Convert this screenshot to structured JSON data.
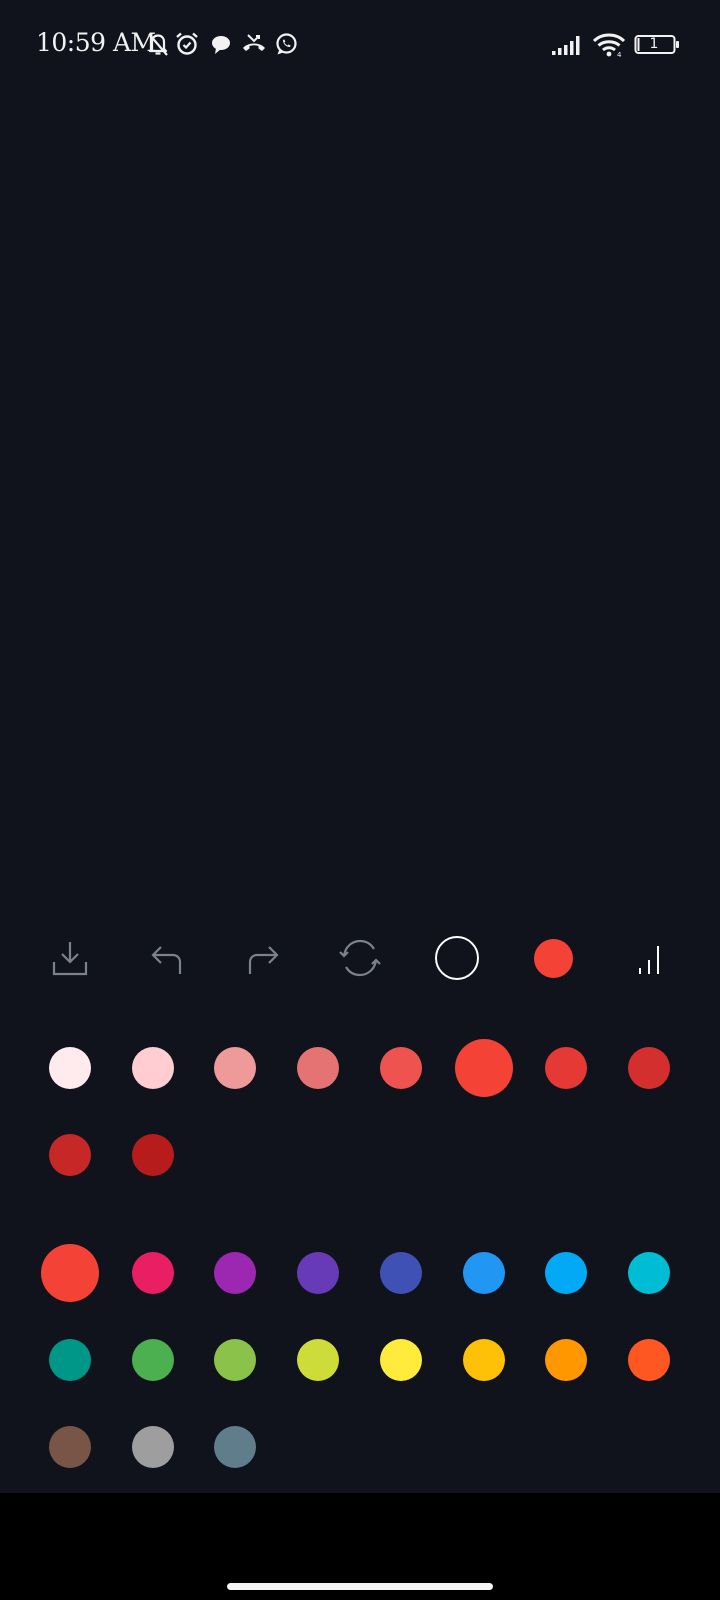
{
  "status_bar": {
    "time": "10:59 AM",
    "battery_level": "1",
    "left_icons": [
      "bell-off-icon",
      "alarm-icon",
      "chat-bubble-icon",
      "missed-call-icon",
      "whatsapp-icon"
    ],
    "right_icons": [
      "signal-icon",
      "wifi-icon",
      "battery-icon"
    ]
  },
  "toolbar": {
    "tools": [
      {
        "name": "download-tool",
        "icon": "download-icon"
      },
      {
        "name": "undo-tool",
        "icon": "undo-icon"
      },
      {
        "name": "redo-tool",
        "icon": "redo-icon"
      },
      {
        "name": "refresh-tool",
        "icon": "refresh-icon"
      },
      {
        "name": "eraser-tool",
        "icon": "circle-outline-icon"
      },
      {
        "name": "current-color-tool",
        "icon": "color-dot-icon",
        "color": "#f44336"
      },
      {
        "name": "stroke-size-tool",
        "icon": "stroke-size-icon"
      }
    ]
  },
  "palette": {
    "selected_color": "#f44336",
    "shades": [
      "#ffebee",
      "#ffcdd2",
      "#ef9a9a",
      "#e57373",
      "#ef5350",
      "#f44336",
      "#e53935",
      "#d32f2f",
      "#c62828",
      "#b71c1c"
    ],
    "selected_shade_index": 5,
    "base_colors": [
      "#f44336",
      "#e91e63",
      "#9c27b0",
      "#673ab7",
      "#3f51b5",
      "#2196f3",
      "#03a9f4",
      "#00bcd4",
      "#009688",
      "#4caf50",
      "#8bc34a",
      "#cddc39",
      "#ffeb3b",
      "#ffc107",
      "#ff9800",
      "#ff5722",
      "#795548",
      "#9e9e9e",
      "#607d8b"
    ],
    "selected_base_index": 0
  }
}
